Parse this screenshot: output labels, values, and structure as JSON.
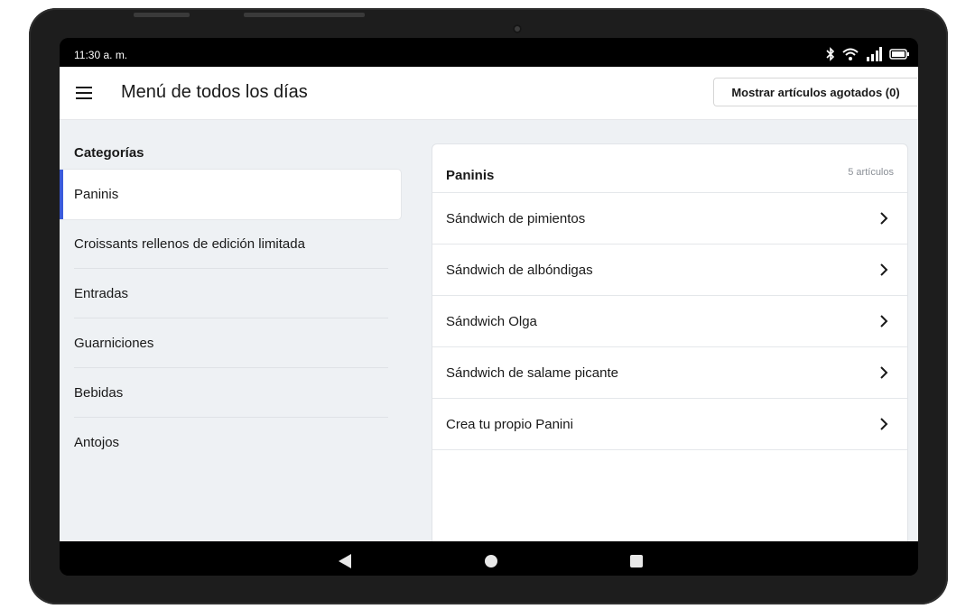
{
  "status": {
    "time": "11:30 a. m."
  },
  "header": {
    "title": "Menú de todos los días",
    "sold_out_button": "Mostrar artículos agotados (0)"
  },
  "sidebar": {
    "heading": "Categorías",
    "items": [
      {
        "label": "Paninis",
        "active": true
      },
      {
        "label": "Croissants rellenos de edición limitada"
      },
      {
        "label": "Entradas"
      },
      {
        "label": "Guarniciones"
      },
      {
        "label": "Bebidas"
      },
      {
        "label": "Antojos"
      }
    ]
  },
  "panel": {
    "title": "Paninis",
    "count": "5 artículos",
    "items": [
      {
        "label": "Sándwich de pimientos"
      },
      {
        "label": "Sándwich de albóndigas"
      },
      {
        "label": "Sándwich Olga"
      },
      {
        "label": "Sándwich de salame picante"
      },
      {
        "label": "Crea tu propio Panini"
      }
    ]
  },
  "colors": {
    "accent": "#3b5bdb",
    "background": "#eef1f4",
    "device": "#1d1d1d"
  },
  "icons": {
    "status": [
      "bluetooth-icon",
      "wifi-icon",
      "signal-icon",
      "battery-icon"
    ],
    "nav": [
      "back-icon",
      "home-icon",
      "recents-icon"
    ],
    "menu": "hamburger-menu-icon",
    "row": "chevron-right-icon"
  }
}
